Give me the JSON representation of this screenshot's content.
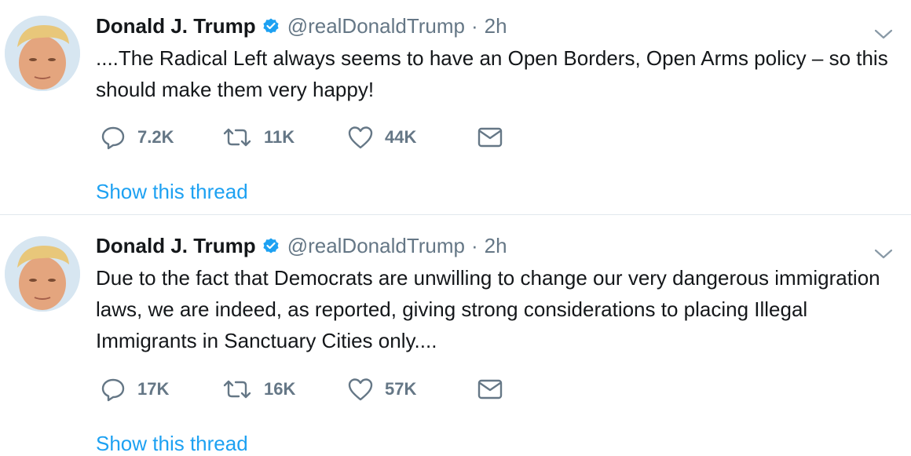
{
  "colors": {
    "link": "#1da1f2",
    "muted": "#657786",
    "text": "#14171a",
    "divider": "#e1e8ed"
  },
  "tweets": [
    {
      "name": "Donald J. Trump",
      "handle": "@realDonaldTrump",
      "separator": "·",
      "time": "2h",
      "text": "....The Radical Left always seems to have an Open Borders, Open Arms policy – so this should make them very happy!",
      "replies": "7.2K",
      "retweets": "11K",
      "likes": "44K",
      "thread_link": "Show this thread"
    },
    {
      "name": "Donald J. Trump",
      "handle": "@realDonaldTrump",
      "separator": "·",
      "time": "2h",
      "text": "Due to the fact that Democrats are unwilling to change our very dangerous immigration laws, we are indeed, as reported, giving strong considerations to placing Illegal Immigrants in Sanctuary Cities only....",
      "replies": "17K",
      "retweets": "16K",
      "likes": "57K",
      "thread_link": "Show this thread"
    }
  ]
}
